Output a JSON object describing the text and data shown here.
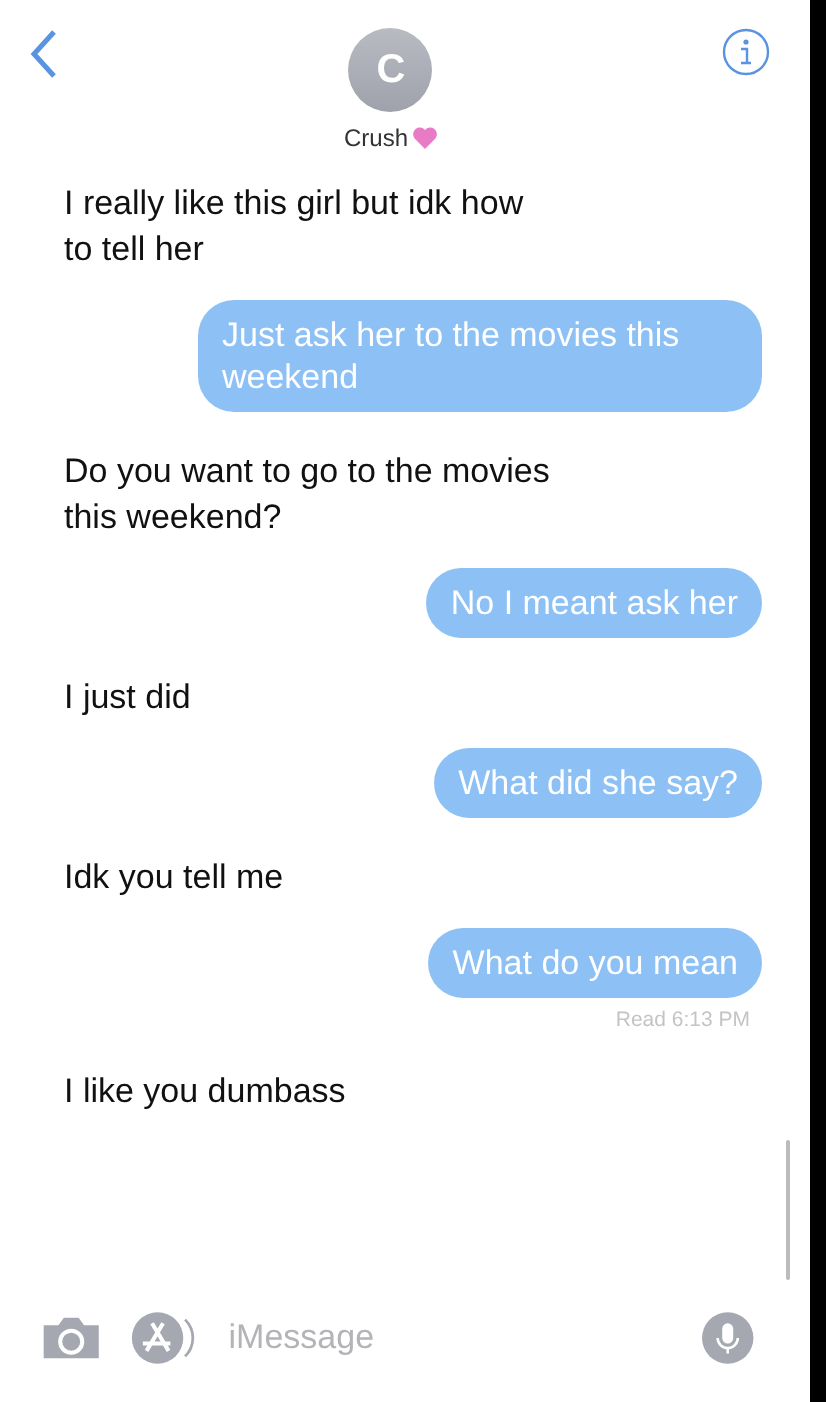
{
  "header": {
    "avatar_initial": "C",
    "contact_name": "Crush"
  },
  "messages": [
    {
      "kind": "received",
      "text": "I really like this girl but idk how to tell her"
    },
    {
      "kind": "sent",
      "text": "Just ask her to the movies this weekend"
    },
    {
      "kind": "received",
      "text": "Do you want to go to the movies this weekend?"
    },
    {
      "kind": "sent",
      "text": "No I meant ask her"
    },
    {
      "kind": "received",
      "text": "I just did"
    },
    {
      "kind": "sent",
      "text": "What did she say?"
    },
    {
      "kind": "received",
      "text": "Idk you tell me"
    },
    {
      "kind": "sent",
      "text": "What do you mean"
    },
    {
      "kind": "receipt",
      "text": "Read 6:13 PM"
    },
    {
      "kind": "received",
      "text": "I like you dumbass"
    }
  ],
  "composer": {
    "placeholder": "iMessage"
  }
}
